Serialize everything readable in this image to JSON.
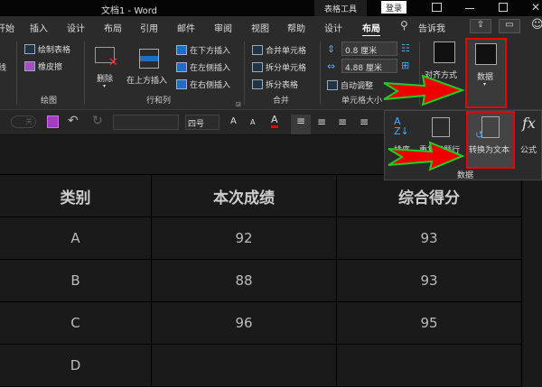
{
  "titlebar": {
    "doc_title": "文档1  -  Word",
    "context_tab": "表格工具",
    "login": "登录"
  },
  "tabs": [
    "开始",
    "插入",
    "设计",
    "布局",
    "引用",
    "邮件",
    "审阅",
    "视图",
    "帮助",
    "设计",
    "布局"
  ],
  "tell_me": "告诉我",
  "ribbon": {
    "left_partial": "线",
    "draw": {
      "items": [
        "绘制表格",
        "橡皮擦"
      ],
      "label": "绘图"
    },
    "rows_cols": {
      "delete": "删除",
      "insert_above": "在上方插入",
      "insert_below": "在下方插入",
      "insert_left": "在左侧插入",
      "insert_right": "在右侧插入",
      "label": "行和列"
    },
    "merge": {
      "items": [
        "合并单元格",
        "拆分单元格",
        "拆分表格"
      ],
      "label": "合并"
    },
    "cell_size": {
      "height": "0.8 厘米",
      "width": "4.88 厘米",
      "autofit": "自动调整",
      "label": "单元格大小"
    },
    "alignment": "对齐方式",
    "data": "数据"
  },
  "qat": {
    "font_size": "四号",
    "toggle": "关"
  },
  "data_dropdown": {
    "items": [
      "排序",
      "重复标题行",
      "转换为文本",
      "公式"
    ],
    "label": "数据"
  },
  "table": {
    "headers": [
      "类别",
      "本次成绩",
      "综合得分"
    ],
    "rows": [
      [
        "A",
        "92",
        "93"
      ],
      [
        "B",
        "88",
        "93"
      ],
      [
        "C",
        "96",
        "95"
      ],
      [
        "D",
        "",
        ""
      ]
    ]
  },
  "colors": {
    "accent_red": "#e00000",
    "arrow_outline": "#22cc22",
    "bg": "#1a1a1a"
  }
}
